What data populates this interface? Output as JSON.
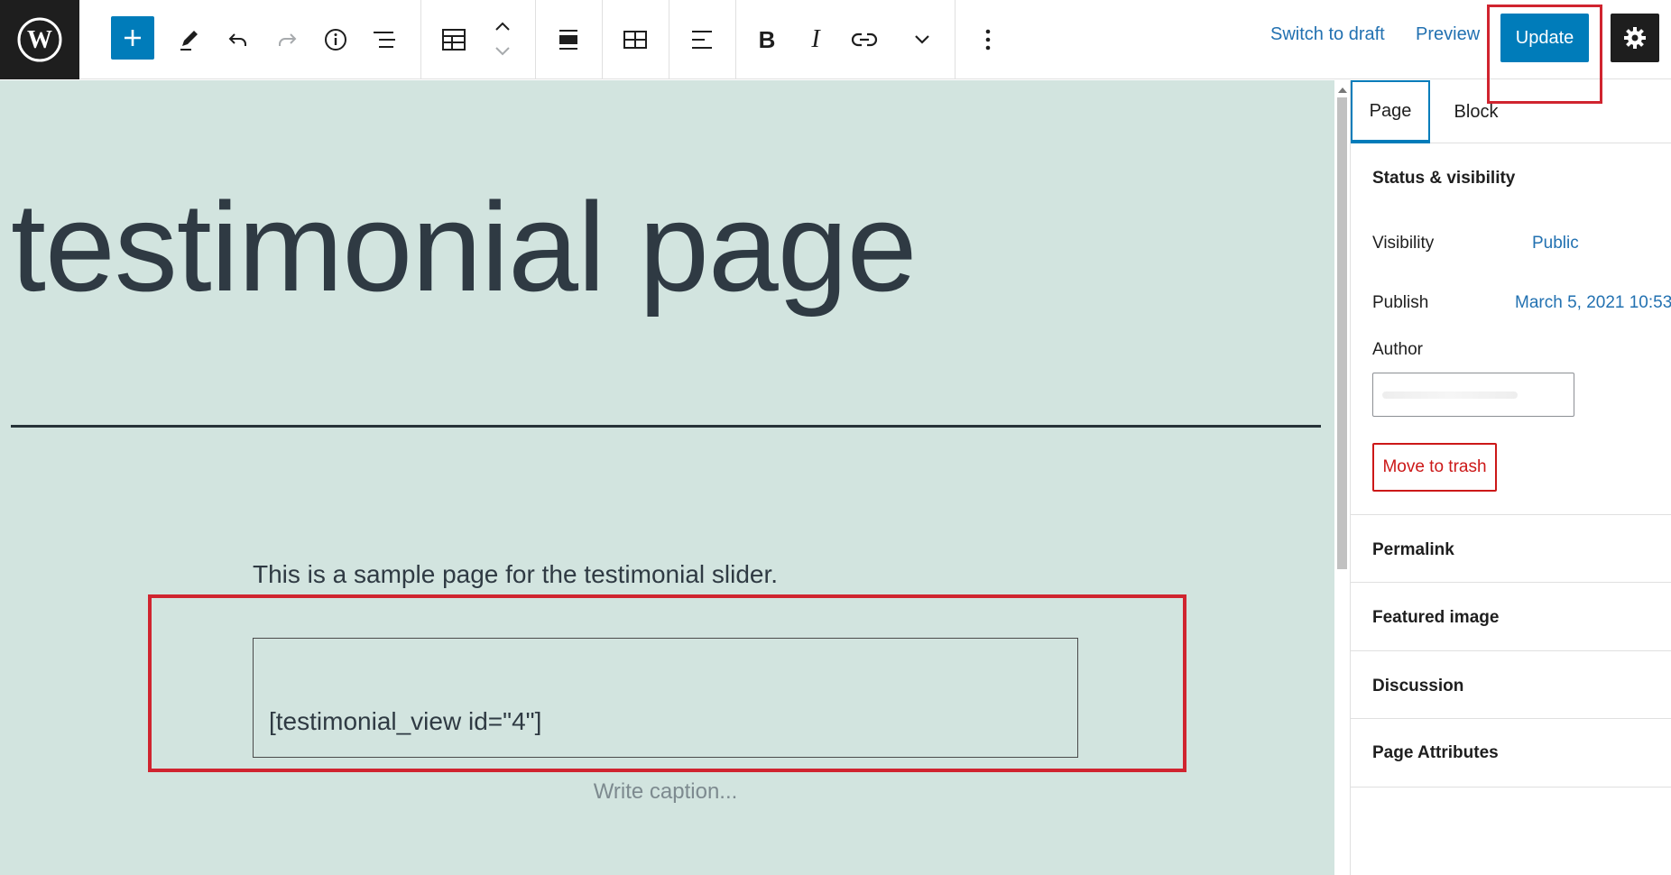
{
  "toolbar": {
    "switch_to_draft": "Switch to draft",
    "preview": "Preview",
    "update": "Update",
    "icons": [
      "wordpress-logo-icon",
      "plus-icon",
      "pen-icon",
      "undo-icon",
      "redo-icon",
      "info-icon",
      "list-view-icon",
      "table-icon",
      "move-up-icon",
      "move-down-icon",
      "align-icon",
      "grid-icon",
      "text-align-icon",
      "bold-icon",
      "italic-icon",
      "link-icon",
      "chevron-down-icon",
      "more-options-icon",
      "gear-icon"
    ]
  },
  "editor": {
    "title": "testimonial page",
    "intro": "This is a sample page for the testimonial slider.",
    "shortcode": "[testimonial_view id=\"4\"]",
    "caption_placeholder": "Write caption..."
  },
  "sidebar": {
    "tabs": [
      "Page",
      "Block"
    ],
    "status_heading": "Status & visibility",
    "visibility_label": "Visibility",
    "visibility_value": "Public",
    "publish_label": "Publish",
    "publish_value": "March 5, 2021 10:53",
    "author_label": "Author",
    "trash": "Move to trash",
    "panels": [
      "Permalink",
      "Featured image",
      "Discussion",
      "Page Attributes"
    ]
  },
  "colors": {
    "accent": "#007cba",
    "canvas_bg": "#d2e4df",
    "highlight": "#d0242f",
    "danger": "#cc1818"
  }
}
